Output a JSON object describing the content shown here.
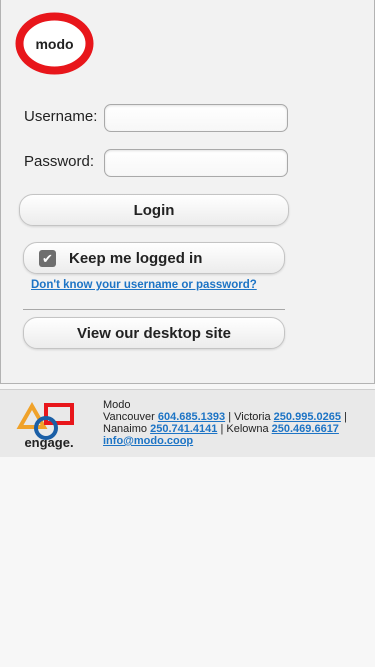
{
  "brand": {
    "logo_text": "modo",
    "logo_color": "#e8161b"
  },
  "login": {
    "username_label": "Username:",
    "username_value": "",
    "password_label": "Password:",
    "password_value": "",
    "login_button": "Login",
    "keep_logged_in_label": "Keep me logged in",
    "keep_logged_in_checked": true,
    "forgot_link": "Don't know your username or password?",
    "desktop_button": "View our desktop site"
  },
  "footer": {
    "partner_logo_text": "engage.",
    "company": "Modo",
    "vancouver_label": "Vancouver",
    "vancouver_phone": "604.685.1393",
    "victoria_label": "Victoria",
    "victoria_phone": "250.995.0265",
    "nanaimo_label": "Nanaimo",
    "nanaimo_phone": "250.741.4141",
    "kelowna_label": "Kelowna",
    "kelowna_phone": "250.469.6617",
    "email": "info@modo.coop",
    "separator": "|"
  },
  "colors": {
    "link": "#1d74c5",
    "accent_red": "#e8161b",
    "engage_orange": "#f0a22a",
    "engage_blue": "#1b5fa6"
  }
}
